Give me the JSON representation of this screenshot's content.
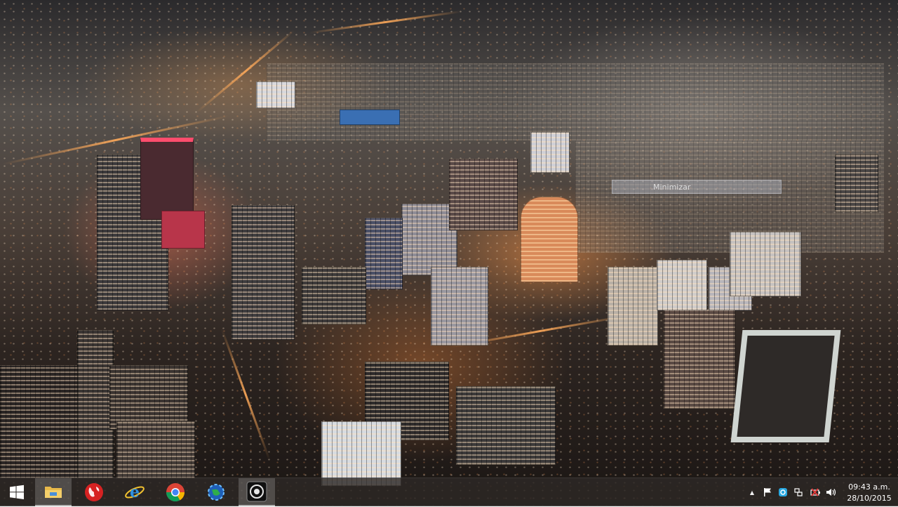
{
  "desktop": {
    "wallpaper": "night-city-aerial",
    "ghost_label_text": "Minimizar"
  },
  "taskbar": {
    "apps": [
      {
        "icon": "windows-start-icon",
        "tooltip": ""
      },
      {
        "icon": "file-explorer-icon",
        "tooltip": ""
      },
      {
        "icon": "globe-icon",
        "tooltip": ""
      },
      {
        "icon": "internet-explorer-icon",
        "tooltip": ""
      },
      {
        "icon": "chrome-icon",
        "tooltip": ""
      },
      {
        "icon": "gear-globe-icon",
        "tooltip": ""
      },
      {
        "icon": "camera-app-icon",
        "tooltip": ""
      }
    ],
    "tray": {
      "show_hidden_icon": "▲",
      "icons": [
        "flag-icon",
        "dropbox-icon",
        "network-icon",
        "battery-icon",
        "volume-icon"
      ]
    },
    "clock": {
      "time": "09:43 a.m.",
      "date": "28/10/2015"
    }
  },
  "colors": {
    "taskbar_bg": "#2d2826",
    "accent_orange": "#ff9a50"
  }
}
